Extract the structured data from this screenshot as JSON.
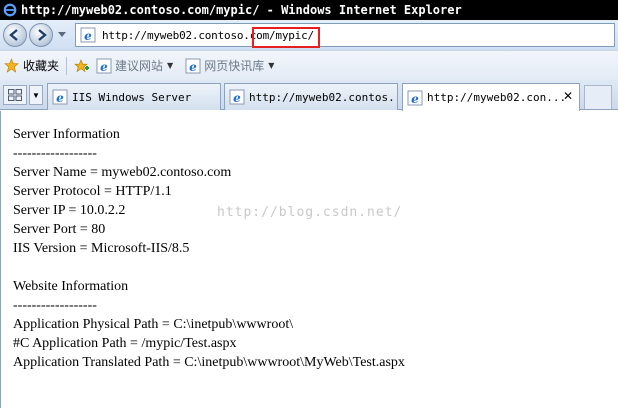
{
  "window": {
    "title": "http://myweb02.contoso.com/mypic/ - Windows Internet Explorer"
  },
  "address": {
    "url": "http://myweb02.contoso.com/mypic/"
  },
  "favorites": {
    "favorites_label": "收藏夹",
    "suggested_label": "建议网站",
    "webslice_label": "网页快讯库"
  },
  "tabs": [
    {
      "label": "IIS Windows Server"
    },
    {
      "label": "http://myweb02.contos..."
    },
    {
      "label": "http://myweb02.con..."
    }
  ],
  "tab_close": "✕",
  "content": {
    "lines": [
      "Server Information",
      "------------------",
      "Server Name = myweb02.contoso.com",
      "Server Protocol = HTTP/1.1",
      "Server IP = 10.0.2.2",
      "Server Port = 80",
      "IIS Version = Microsoft-IIS/8.5",
      "",
      "Website Information",
      "------------------",
      "Application Physical Path = C:\\inetpub\\wwwroot\\",
      "#C Application Path = /mypic/Test.aspx",
      "Application Translated Path = C:\\inetpub\\wwwroot\\MyWeb\\Test.aspx"
    ],
    "watermark": "http://blog.csdn.net/"
  },
  "colors": {
    "highlight": "#e62020",
    "ie_blue": "#1f6fd1",
    "star": "#f2b21b"
  }
}
